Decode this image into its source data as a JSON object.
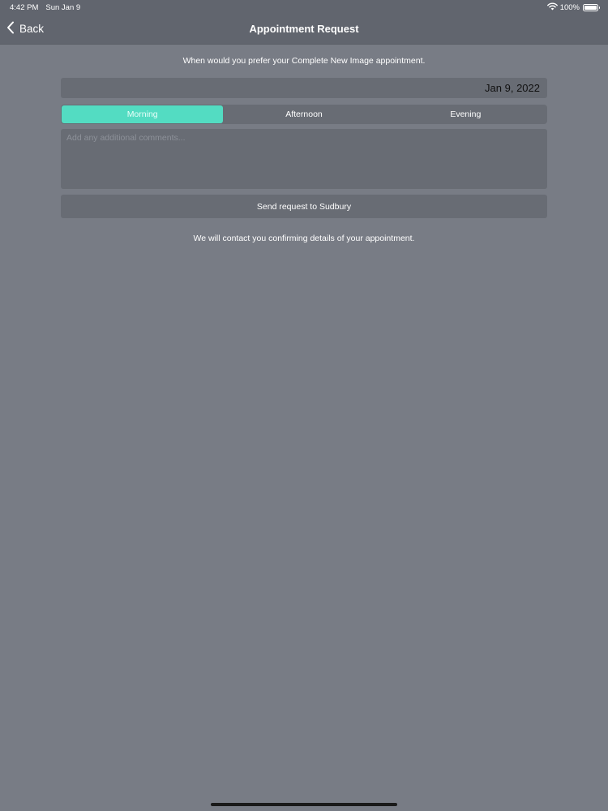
{
  "status_bar": {
    "time": "4:42 PM",
    "date": "Sun Jan 9",
    "battery_text": "100%",
    "battery_level": 1.0,
    "icons": [
      "wifi-icon",
      "battery-icon"
    ]
  },
  "nav": {
    "back_label": "Back",
    "title": "Appointment Request",
    "back_icon": "chevron-left-icon"
  },
  "form": {
    "prompt": "When would you prefer your Complete New Image appointment.",
    "date_value": "Jan 9, 2022",
    "time_of_day": {
      "options": [
        "Morning",
        "Afternoon",
        "Evening"
      ],
      "selected": "Morning"
    },
    "comments_placeholder": "Add any additional comments...",
    "comments_value": "",
    "send_label": "Send request to Sudbury",
    "confirmation": "We will contact you confirming details of your appointment."
  },
  "colors": {
    "background": "#787c85",
    "nav_background": "#61656e",
    "field_background": "#686c74",
    "accent": "#53dcc2"
  }
}
